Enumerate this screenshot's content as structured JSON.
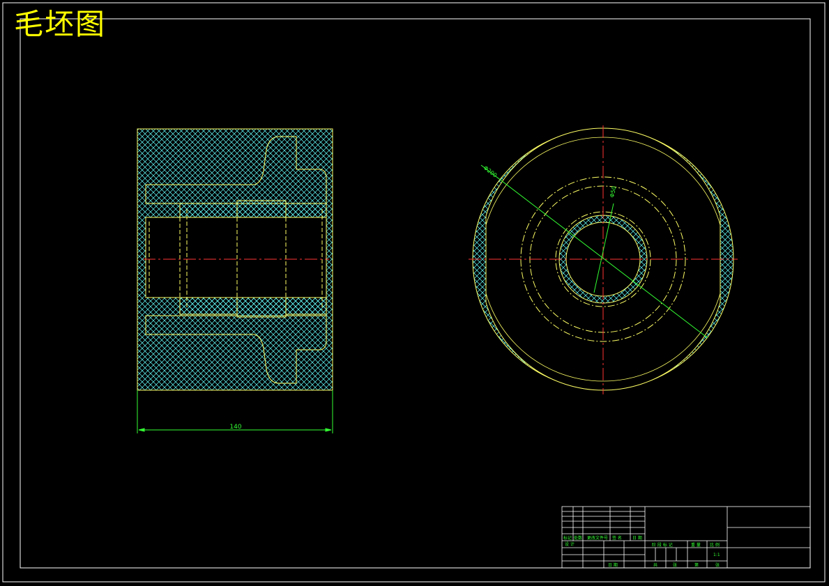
{
  "drawing": {
    "title": "毛坯图",
    "dim_length": "140",
    "dim_outer_dia": "Φ200",
    "dim_inner_dia": "Φ50"
  },
  "title_block": {
    "row_labels": [
      "标记",
      "处数",
      "更改文件号",
      "签 名",
      "日 期"
    ],
    "design_label": "设 计",
    "approve_label": "日 期",
    "stage_labels": [
      "阶 段 标 记",
      "重 量",
      "比 例"
    ],
    "scale": "1:1",
    "sheet_labels": [
      "共",
      "张",
      "第",
      "张"
    ]
  },
  "colors": {
    "background": "#000000",
    "frame": "#ffffff",
    "outline": "#ffff66",
    "hatch": "#66ffff",
    "center": "#ff3333",
    "dimension": "#33ff33",
    "title": "#ffff00"
  }
}
